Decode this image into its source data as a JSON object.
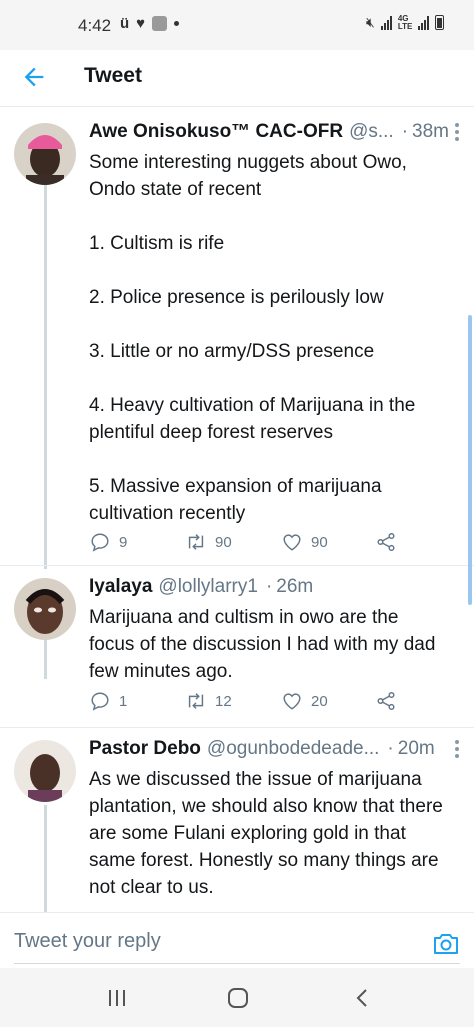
{
  "status_bar": {
    "time": "4:42"
  },
  "header": {
    "title": "Tweet"
  },
  "tweets": [
    {
      "name": "Awe Onisokuso™ CAC-OFR",
      "handle": "@s...",
      "time": "38m",
      "lines": [
        "Some interesting nuggets about Owo,",
        "Ondo state of recent",
        "",
        "1. Cultism is rife",
        "",
        "2. Police presence is perilously low",
        "",
        "3. Little or no army/DSS presence",
        "",
        "4. Heavy cultivation of Marijuana in the",
        "plentiful deep forest reserves",
        "",
        "5. Massive expansion of marijuana",
        "cultivation recently"
      ],
      "replies": "9",
      "retweets": "90",
      "likes": "90"
    },
    {
      "name": "Iyalaya",
      "handle": "@lollylarry1",
      "time": "26m",
      "lines": [
        "Marijuana and cultism in owo are the",
        "focus of the discussion I had with my dad",
        "few minutes ago."
      ],
      "replies": "1",
      "retweets": "12",
      "likes": "20"
    },
    {
      "name": "Pastor Debo",
      "handle": "@ogunbodedeade...",
      "time": "20m",
      "lines": [
        "As we discussed the issue of marijuana",
        "plantation, we should also know that there",
        "are some Fulani exploring gold in that",
        "same forest. Honestly so many things are",
        "not clear to us."
      ]
    }
  ],
  "reply_bar": {
    "placeholder": "Tweet your reply"
  },
  "colors": {
    "accent": "#1da1f2",
    "secondary_text": "#657786",
    "divider": "#e6ecf0"
  },
  "icons": [
    "back-arrow-icon",
    "more-icon",
    "reply-icon",
    "retweet-icon",
    "like-icon",
    "share-icon",
    "camera-icon",
    "recent-apps-icon",
    "home-icon",
    "back-icon"
  ]
}
